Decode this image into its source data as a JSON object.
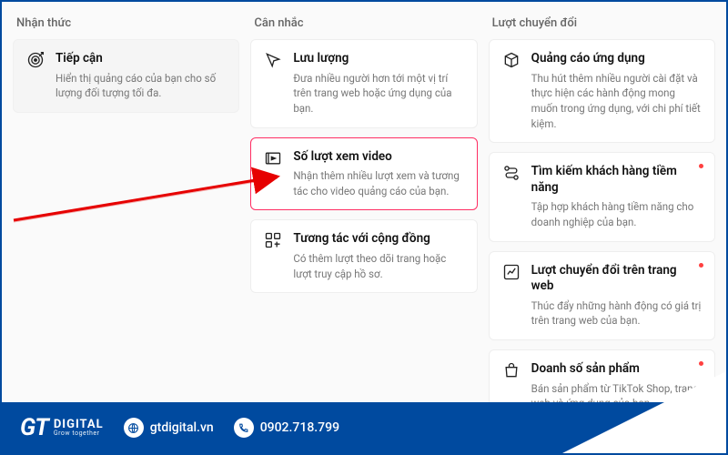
{
  "columns": {
    "awareness": {
      "header": "Nhận thức"
    },
    "consideration": {
      "header": "Cân nhắc"
    },
    "conversion": {
      "header": "Lượt chuyển đổi"
    }
  },
  "cards": {
    "reach": {
      "title": "Tiếp cận",
      "desc": "Hiển thị quảng cáo của bạn cho số lượng đối tượng tối đa."
    },
    "traffic": {
      "title": "Lưu lượng",
      "desc": "Đưa nhiều người hơn tới một vị trí trên trang web hoặc ứng dụng của bạn."
    },
    "videoViews": {
      "title": "Số lượt xem video",
      "desc": "Nhận thêm nhiều lượt xem và tương tác cho video quảng cáo của bạn."
    },
    "community": {
      "title": "Tương tác với cộng đồng",
      "desc": "Có thêm lượt theo dõi trang hoặc lượt truy cập hồ sơ."
    },
    "appPromo": {
      "title": "Quảng cáo ứng dụng",
      "desc": "Thu hút thêm nhiều người cài đặt và thực hiện các hành động mong muốn trong ứng dụng, với chi phí tiết kiệm."
    },
    "leadGen": {
      "title": "Tìm kiếm khách hàng tiềm năng",
      "desc": "Tập hợp khách hàng tiềm năng cho doanh nghiệp của bạn."
    },
    "webConv": {
      "title": "Lượt chuyển đổi trên trang web",
      "desc": "Thúc đẩy những hành động có giá trị trên trang web của bạn."
    },
    "sales": {
      "title": "Doanh số sản phẩm",
      "desc": "Bán sản phẩm từ TikTok Shop, trang web và ứng dụng của bạn."
    }
  },
  "footer": {
    "brandBig": "DIGITAL",
    "brandSmall": "Grow together",
    "website": "gtdigital.vn",
    "phone": "0902.718.799"
  }
}
